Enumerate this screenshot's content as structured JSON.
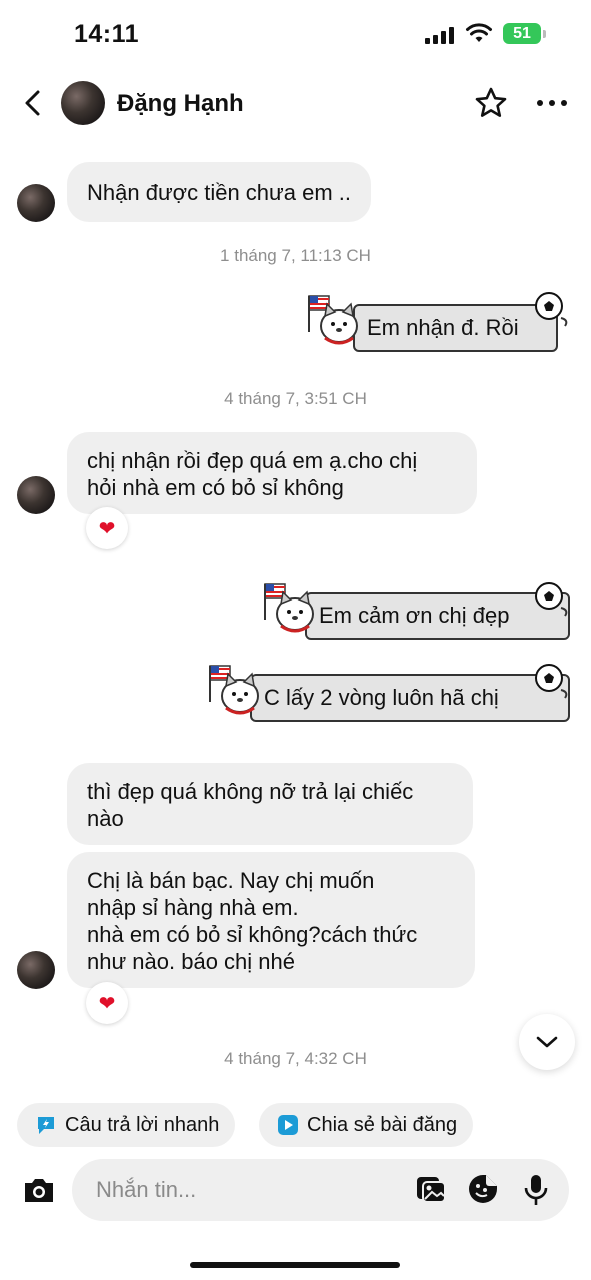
{
  "status_bar": {
    "time": "14:11",
    "battery": "51"
  },
  "header": {
    "contact_name": "Đặng Hạnh"
  },
  "messages": [
    {
      "text": "Nhận được tiền chưa em .."
    },
    {
      "text": "chị nhận rồi đẹp quá em ạ.cho chị\nhỏi nhà em có bỏ sỉ không"
    },
    {
      "text": "thì đẹp quá không nỡ trả lại chiếc\nnào"
    },
    {
      "text": "Chị là bán bạc. Nay chị muốn\nnhập sỉ hàng nhà em.\nnhà em có bỏ sỉ không?cách thức\nnhư nào. báo chị nhé"
    }
  ],
  "outgoing": [
    {
      "text": "Em nhận đ. Rồi"
    },
    {
      "text": "Em cảm ơn chị đẹp"
    },
    {
      "text": "C lấy 2 vòng luôn hã chị"
    }
  ],
  "timestamps": [
    "1 tháng 7, 11:13 CH",
    "4 tháng 7, 3:51 CH",
    "4 tháng 7, 4:32 CH"
  ],
  "reactions": {
    "emoji": "❤"
  },
  "quick_actions": [
    {
      "label": "Câu trả lời nhanh"
    },
    {
      "label": "Chia sẻ bài đăng"
    }
  ],
  "composer": {
    "placeholder": "Nhắn tin..."
  },
  "colors": {
    "bubble": "#efefef",
    "accent_quick_reply": "#1c9bd6",
    "reaction": "#e0102a",
    "battery": "#34c759"
  }
}
